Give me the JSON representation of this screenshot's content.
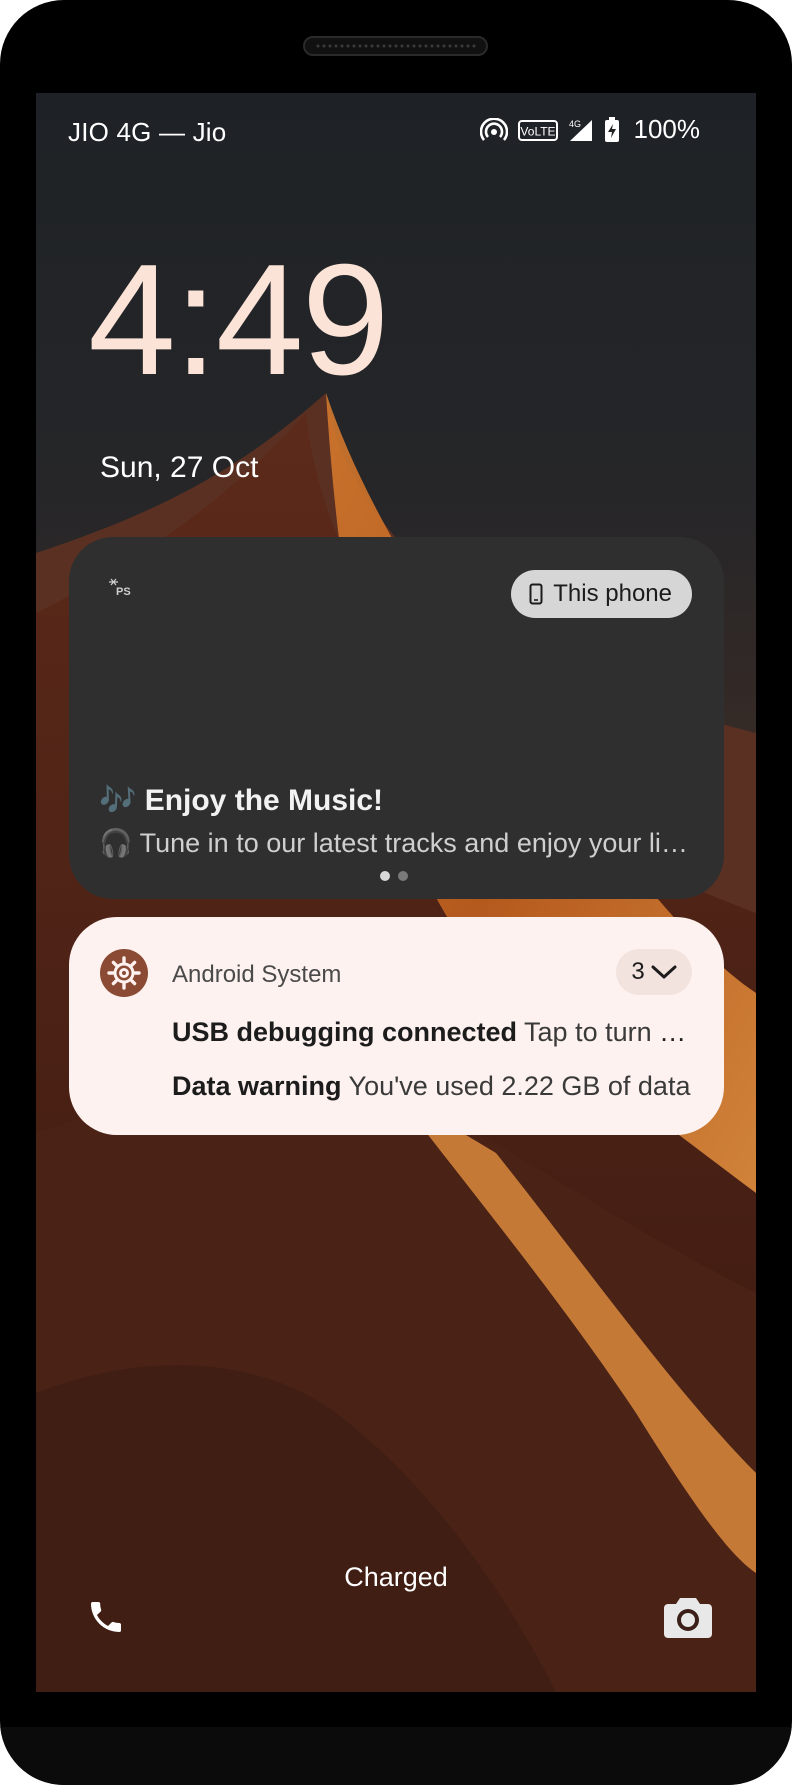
{
  "status_bar": {
    "carrier": "JIO 4G — Jio",
    "volte_label": "VoLTE",
    "network_label": "4G",
    "battery_percent": "100%",
    "icons": [
      "hotspot-icon",
      "volte-icon",
      "signal-icon",
      "battery-charging-icon"
    ]
  },
  "lockscreen": {
    "time": "4:49",
    "date": "Sun, 27 Oct",
    "footer_status": "Charged"
  },
  "media_player": {
    "app_logo_text": "PS",
    "output_device_label": "This phone",
    "title": "🎶 Enjoy the Music!",
    "subtitle": "🎧 Tune in to our latest tracks and enjoy your listening",
    "pages": 2,
    "active_page": 1
  },
  "notification": {
    "app_name": "Android System",
    "count": "3",
    "items": [
      {
        "title": "USB debugging connected",
        "body": "Tap to turn off USB debugging"
      },
      {
        "title": "Data warning",
        "body": "You've used 2.22 GB of data"
      }
    ]
  },
  "shortcuts": {
    "left": "phone-icon",
    "right": "camera-icon"
  },
  "colors": {
    "clock": "#fbe3d8",
    "media_card": "#2f2f2f",
    "notification_card": "#fdf2ef",
    "app_icon_bg": "#8a4a34"
  }
}
